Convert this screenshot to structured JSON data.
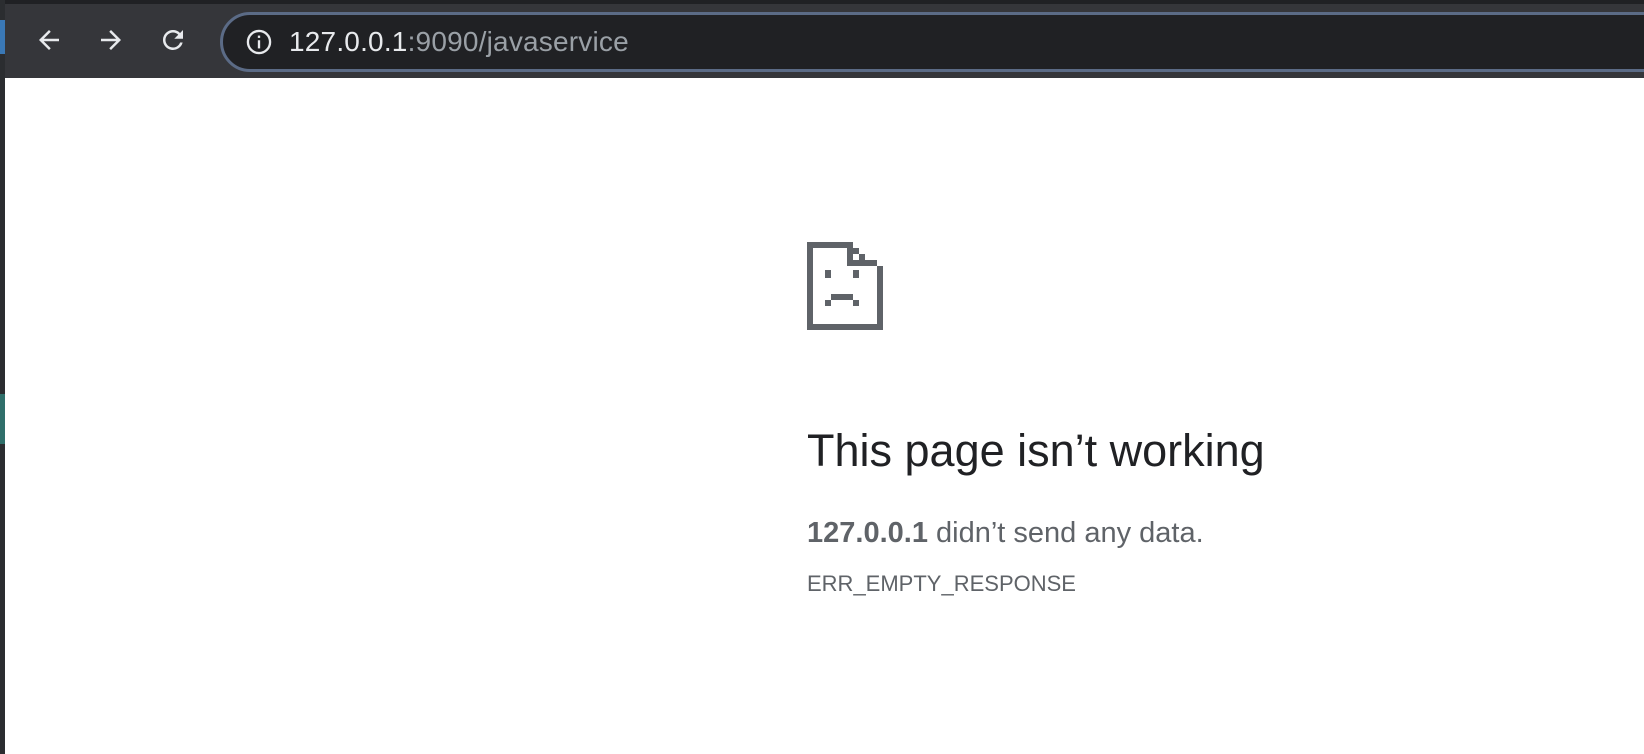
{
  "browser": {
    "url_host": "127.0.0.1",
    "url_rest": ":9090/javaservice",
    "colors": {
      "toolbar_bg": "#35363a",
      "omnibox_bg": "#202124",
      "omnibox_border": "#5b6b86"
    }
  },
  "toolbar": {
    "back_icon": "arrow-left-icon",
    "forward_icon": "arrow-right-icon",
    "reload_icon": "reload-icon",
    "info_icon": "info-icon"
  },
  "error_page": {
    "icon": "sad-file-icon",
    "title": "This page isn’t working",
    "host": "127.0.0.1",
    "message": " didn’t send any data.",
    "code": "ERR_EMPTY_RESPONSE"
  }
}
